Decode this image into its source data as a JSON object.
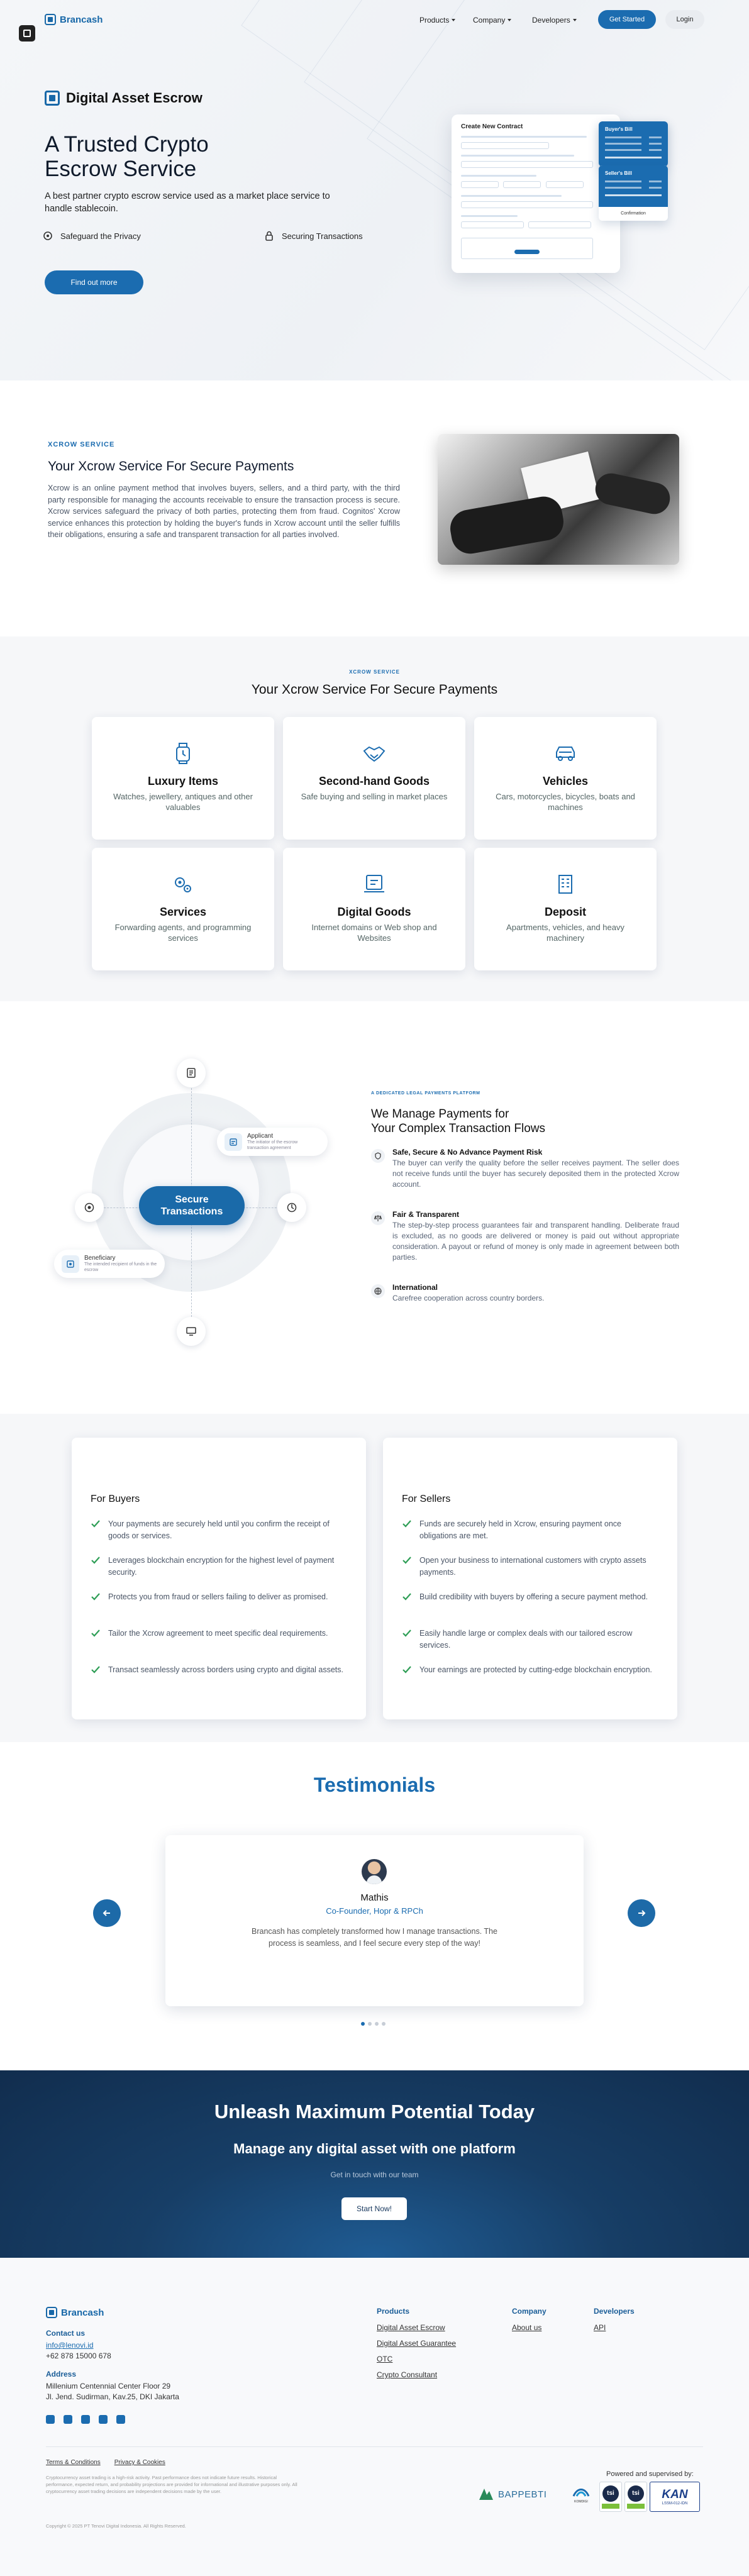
{
  "brand": {
    "name": "Brancash",
    "accent": "#1b6cb0",
    "dark": "#112d4e"
  },
  "nav": {
    "items": [
      {
        "label": "Products"
      },
      {
        "label": "Company"
      },
      {
        "label": "Developers"
      }
    ],
    "get_started": "Get Started",
    "login": "Login"
  },
  "hero": {
    "product": "Digital Asset Escrow",
    "headline_1": "A Trusted Crypto",
    "headline_2": "Escrow Service",
    "subtitle": "A best partner crypto escrow service used as a market place service to handle stablecoin.",
    "feature_1": "Safeguard the Privacy",
    "feature_2": "Securing Transactions",
    "cta": "Find out more",
    "mockup": {
      "title": "Create New Contract",
      "card_1": "Buyer's Bill",
      "card_2": "Seller's Bill",
      "card_3": "Confirmation"
    }
  },
  "about": {
    "tag": "XCROW SERVICE",
    "title": "Your Xcrow Service For Secure Payments",
    "body": "Xcrow is an online payment method that involves buyers, sellers, and a third party, with the third party responsible for managing the accounts receivable to ensure the transaction process is secure. Xcrow services safeguard the privacy of both parties, protecting them from fraud. Cognitos' Xcrow service enhances this protection by holding the buyer's funds in Xcrow account until the seller fulfills their obligations, ensuring a safe and transparent transaction for all parties involved."
  },
  "services": {
    "tag": "XCROW SERVICE",
    "title": "Your Xcrow Service For Secure Payments",
    "items": [
      {
        "title": "Luxury Items",
        "desc": "Watches, jewellery, antiques and other valuables",
        "icon": "watch-icon"
      },
      {
        "title": "Second-hand Goods",
        "desc": "Safe buying and selling in market places",
        "icon": "handshake-icon"
      },
      {
        "title": "Vehicles",
        "desc": "Cars, motorcycles, bicycles, boats and machines",
        "icon": "car-icon"
      },
      {
        "title": "Services",
        "desc": "Forwarding agents, and programming services",
        "icon": "gears-icon"
      },
      {
        "title": "Digital Goods",
        "desc": "Internet domains or Web shop and Websites",
        "icon": "laptop-icon"
      },
      {
        "title": "Deposit",
        "desc": "Apartments, vehicles, and heavy machinery",
        "icon": "building-icon"
      }
    ]
  },
  "manage": {
    "center": "Secure Transactions",
    "applicant": {
      "title": "Applicant",
      "sub": "The initiator of the escrow transaction agreement"
    },
    "beneficiary": {
      "title": "Beneficiary",
      "sub": "The intended recipient of funds in the escrow"
    },
    "tag": "A DEDICATED LEGAL PAYMENTS PLATFORM",
    "title_1": "We Manage Payments for",
    "title_2": "Your Complex Transaction Flows",
    "items": [
      {
        "title": "Safe, Secure & No Advance Payment Risk",
        "desc": "The buyer can verify the quality before the seller receives payment. The seller does not receive funds until the buyer has securely deposited them in the protected Xcrow account."
      },
      {
        "title": "Fair & Transparent",
        "desc": "The step-by-step process guarantees fair and transparent handling. Deliberate fraud is excluded, as no goods are delivered or money is paid out without appropriate consideration. A payout or refund of money is only made in agreement between both parties."
      },
      {
        "title": "International",
        "desc": "Carefree cooperation across country borders."
      }
    ]
  },
  "buyers": {
    "title": "For Buyers",
    "items": [
      "Your payments are securely held until you confirm the receipt of goods or services.",
      "Leverages blockchain encryption for the highest level of payment security.",
      "Protects you from fraud or sellers failing to deliver as promised.",
      "Tailor the Xcrow agreement to meet specific deal requirements.",
      "Transact seamlessly across borders using crypto and digital assets."
    ]
  },
  "sellers": {
    "title": "For Sellers",
    "items": [
      "Funds are securely held in Xcrow, ensuring payment once obligations are met.",
      "Open your business to international customers with crypto assets payments.",
      "Build credibility with buyers by offering a secure payment method.",
      "Easily handle large or complex deals with our tailored escrow services.",
      "Your earnings are protected by cutting-edge blockchain encryption."
    ]
  },
  "testimonials": {
    "title": "Testimonials",
    "name": "Mathis",
    "role": "Co-Founder, Hopr & RPCh",
    "quote": "Brancash has completely transformed how I manage transactions. The process is seamless, and I feel secure every step of the way!",
    "active_dot": 1,
    "dot_count": 4
  },
  "cta": {
    "title": "Unleash Maximum Potential Today",
    "subtitle": "Manage any digital asset with one platform",
    "text": "Get in touch with our team",
    "button": "Start Now!"
  },
  "footer": {
    "contact_label": "Contact us",
    "email": "info@lenovi.id",
    "phone": "+62 878 15000 678",
    "address_label": "Address",
    "address_1": "Millenium Centennial Center Floor 29",
    "address_2": "Jl. Jend. Sudirman, Kav.25, DKI Jakarta",
    "cols": [
      {
        "title": "Products",
        "links": [
          "Digital Asset Escrow",
          "Digital Asset Guarantee",
          "OTC",
          "Crypto Consultant"
        ]
      },
      {
        "title": "Company",
        "links": [
          "About us"
        ]
      },
      {
        "title": "Developers",
        "links": [
          "API"
        ]
      }
    ],
    "terms": "Terms & Conditions",
    "privacy": "Privacy & Cookies",
    "disclaimer": "Cryptocurrency asset trading is a high-risk activity. Past performance does not indicate future results. Historical performance, expected return, and probability projections are provided for informational and illustrative purposes only. All cryptocurrency asset trading decisions are independent decisions made by the user.",
    "copyright": "Copyright © 2025 PT Tenovi Digital Indonesia. All Rights Reserved.",
    "supervised": "Powered and supervised by:",
    "regulator_1": "BAPPEBTI",
    "regulator_2": "KOMDIGI",
    "cert_1": "tsi",
    "cert_2": "tsi",
    "cert_3": "KAN",
    "cert_3_sub": "LSSM-012-IDN"
  }
}
